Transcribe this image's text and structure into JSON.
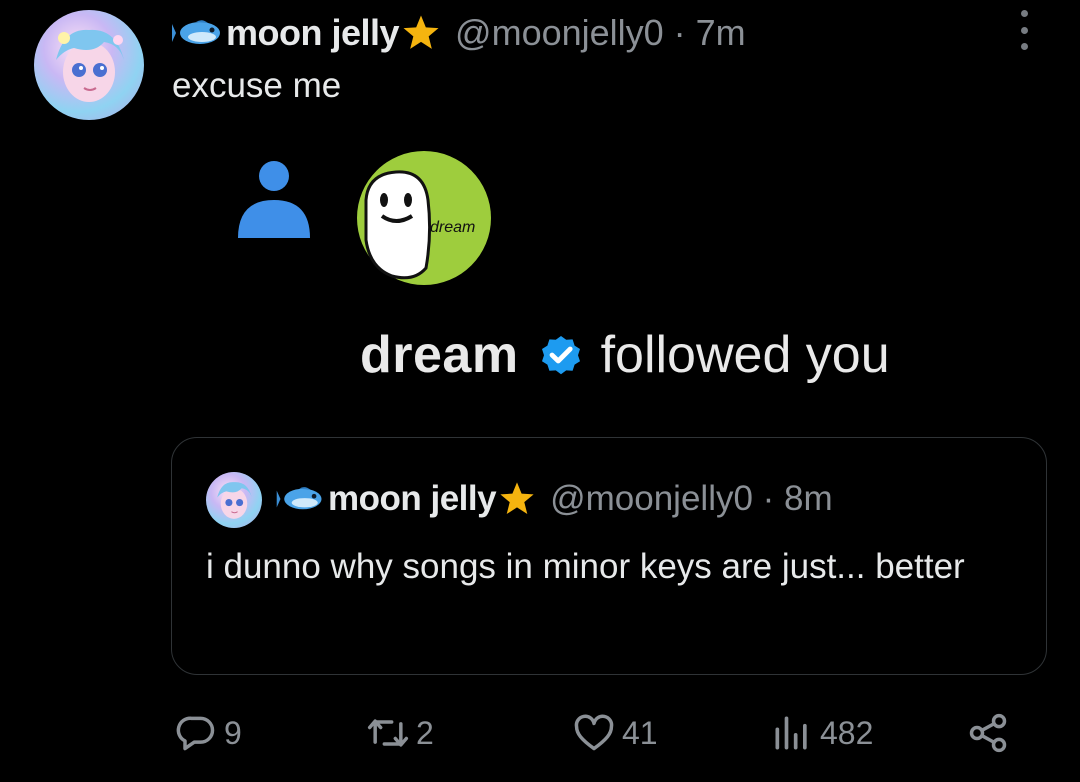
{
  "tweet": {
    "author_name": "moon jelly",
    "author_handle": "@moonjelly0 · 7m",
    "text": "excuse me"
  },
  "embedded_image": {
    "follower_name": "dream",
    "follow_text": "followed you",
    "logo_label": "dream"
  },
  "quoted_tweet": {
    "author_name": "moon jelly",
    "author_handle": "@moonjelly0 · 8m",
    "text": "i dunno why songs in minor keys are just... better"
  },
  "actions": {
    "replies": "9",
    "retweets": "2",
    "likes": "41",
    "views": "482"
  },
  "icons": {
    "author_prefix": "fish-icon",
    "author_suffix": "star-icon",
    "more": "more-dots-icon",
    "person": "person-icon",
    "verified": "verified-badge-icon",
    "reply": "reply-icon",
    "retweet": "retweet-icon",
    "like": "heart-icon",
    "views": "views-chart-icon",
    "share": "share-icon"
  },
  "colors": {
    "background": "#000000",
    "text": "#e7e9ea",
    "muted": "#8b9096",
    "accent_blue": "#1d9bf0",
    "star": "#f5b40f",
    "dream_green": "#9ecd3d",
    "quote_border": "#2f3336"
  }
}
